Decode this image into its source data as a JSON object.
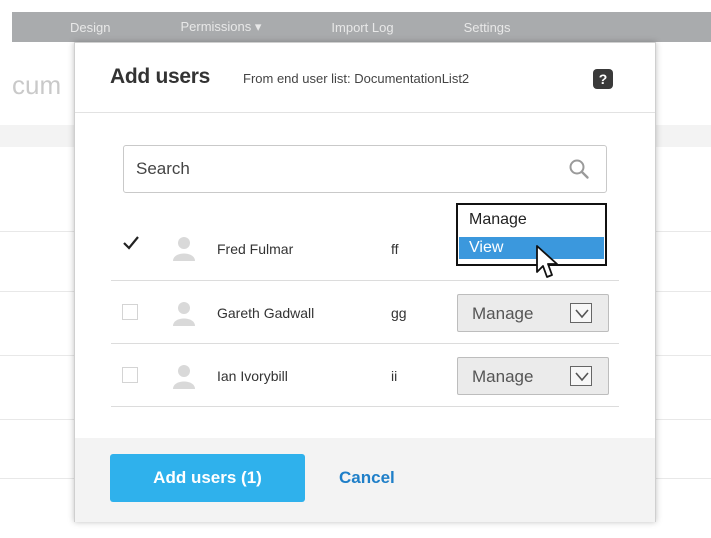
{
  "background": {
    "nav_items": [
      "Design",
      "Permissions ▾",
      "Import Log",
      "Settings"
    ],
    "page_title_fragment": "cum"
  },
  "modal": {
    "title": "Add users",
    "subtitle": "From end user list: DocumentationList2",
    "help_glyph": "?",
    "search": {
      "placeholder": "Search",
      "value": ""
    },
    "users": [
      {
        "name": "Fred Fulmar",
        "initials": "ff",
        "checked": true,
        "role": "View"
      },
      {
        "name": "Gareth Gadwall",
        "initials": "gg",
        "checked": false,
        "role": "Manage"
      },
      {
        "name": "Ian Ivorybill",
        "initials": "ii",
        "checked": false,
        "role": "Manage"
      }
    ],
    "role_dropdown": {
      "options": [
        "Manage",
        "View"
      ],
      "highlighted": "View"
    },
    "footer": {
      "add_label": "Add users (1)",
      "cancel_label": "Cancel"
    }
  },
  "colors": {
    "primary_button": "#2fb1ec",
    "link": "#1f7fc8",
    "highlight": "#3b98dd",
    "nav_bar": "#a9abad"
  },
  "icons": [
    "help-icon",
    "search-icon",
    "checkmark-icon",
    "avatar-icon",
    "chevron-down-icon",
    "cursor-icon"
  ]
}
